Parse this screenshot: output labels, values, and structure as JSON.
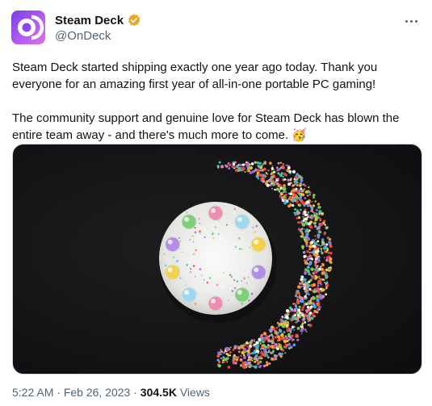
{
  "author": {
    "display_name": "Steam Deck",
    "handle": "@OnDeck",
    "verified_badge_color": "#e8a825",
    "avatar_icon": "steam-deck-logo-icon"
  },
  "menu": {
    "icon": "more-options-icon"
  },
  "tweet": {
    "paragraph_1": "Steam Deck started shipping exactly one year ago today. Thank you everyone for an amazing first year of all-in-one portable PC gaming!",
    "paragraph_2": "The community support and genuine love for Steam Deck has blown the entire team away - and there's much more to come. 🥳"
  },
  "media": {
    "description_icon": "cake-with-sprinkles-image"
  },
  "meta": {
    "time": "5:22 AM",
    "separator": "·",
    "date": "Feb 26, 2023",
    "views_count": "304.5K",
    "views_label": "Views"
  },
  "colors": {
    "text": "#0f1419",
    "secondary": "#536471",
    "border": "#cfd9de"
  }
}
